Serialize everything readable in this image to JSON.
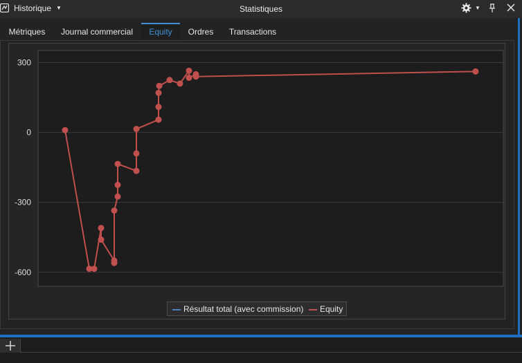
{
  "header": {
    "app_title": "Historique",
    "window_title": "Statistiques"
  },
  "tabs": [
    {
      "label": "Métriques",
      "active": false
    },
    {
      "label": "Journal commercial",
      "active": false
    },
    {
      "label": "Equity",
      "active": true
    },
    {
      "label": "Ordres",
      "active": false
    },
    {
      "label": "Transactions",
      "active": false
    }
  ],
  "icons": {
    "app": "app-logo-icon",
    "dropdown": "chevron-down-icon",
    "settings": "gear-icon",
    "pin": "pin-icon",
    "close": "close-icon",
    "add": "plus-icon"
  },
  "colors": {
    "accent": "#3e8fd6",
    "equity": "#c0504d",
    "resultat": "#4f81bd",
    "plot_bg": "#1d1d1d",
    "grid": "#3c3c3c"
  },
  "chart_data": {
    "type": "line",
    "title": "",
    "xlabel": "",
    "ylabel": "",
    "ylim": [
      -660,
      352
    ],
    "yticks": [
      300,
      0,
      -300,
      -600
    ],
    "grid": true,
    "legend_position": "bottom-center",
    "series": [
      {
        "name": "Résultat total (avec commission)",
        "color": "#4f81bd",
        "points": []
      },
      {
        "name": "Equity",
        "color": "#c0504d",
        "points": [
          {
            "x": 1,
            "y": 10
          },
          {
            "x": 2,
            "y": -585
          },
          {
            "x": 3,
            "y": -585
          },
          {
            "x": 4,
            "y": -410
          },
          {
            "x": 5,
            "y": -460
          },
          {
            "x": 6,
            "y": -550
          },
          {
            "x": 7,
            "y": -560
          },
          {
            "x": 8,
            "y": -335
          },
          {
            "x": 9,
            "y": -275
          },
          {
            "x": 10,
            "y": -225
          },
          {
            "x": 11,
            "y": -135
          },
          {
            "x": 12,
            "y": -165
          },
          {
            "x": 13,
            "y": -90
          },
          {
            "x": 14,
            "y": 15
          },
          {
            "x": 15,
            "y": 55
          },
          {
            "x": 16,
            "y": 110
          },
          {
            "x": 17,
            "y": 170
          },
          {
            "x": 18,
            "y": 200
          },
          {
            "x": 19,
            "y": 225
          },
          {
            "x": 20,
            "y": 210
          },
          {
            "x": 21,
            "y": 265
          },
          {
            "x": 22,
            "y": 235
          },
          {
            "x": 23,
            "y": 250
          },
          {
            "x": 24,
            "y": 240
          },
          {
            "x": 25,
            "y": 262
          }
        ]
      }
    ]
  }
}
